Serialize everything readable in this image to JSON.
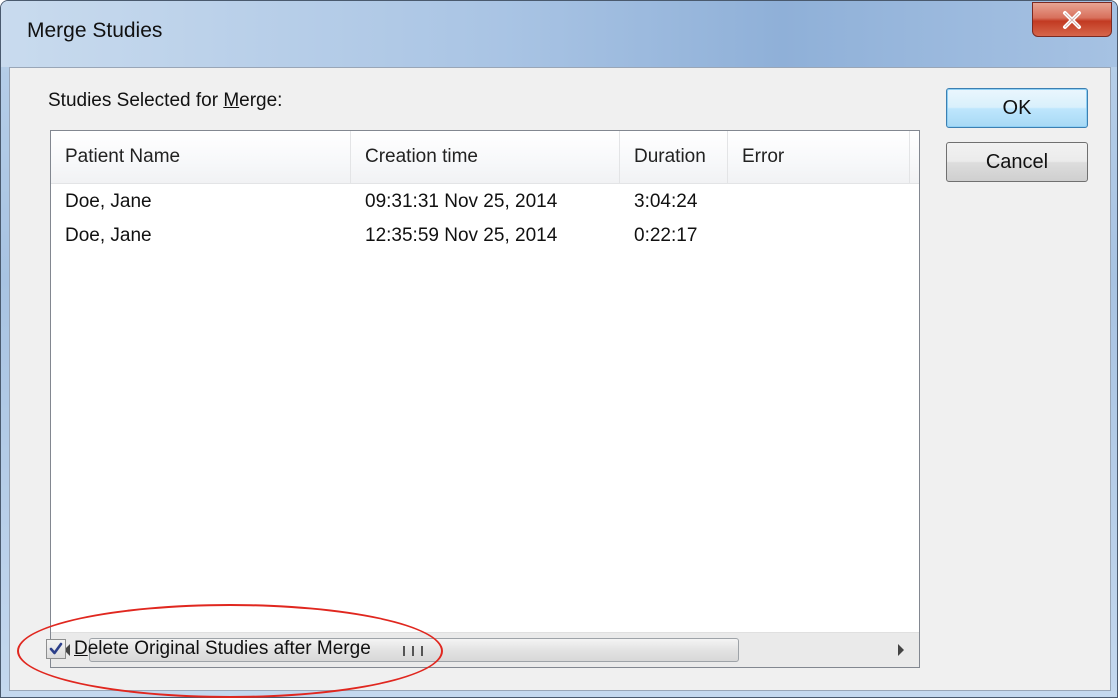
{
  "window": {
    "title": "Merge Studies",
    "close_symbol": "X"
  },
  "dialog": {
    "list_label_prefix": "Studies Selected for ",
    "list_label_accel": "M",
    "list_label_suffix": "erge:",
    "columns": [
      "Patient Name",
      "Creation time",
      "Duration",
      "Error"
    ],
    "rows": [
      {
        "patient": "Doe, Jane",
        "created": "09:31:31 Nov 25, 2014",
        "duration": "3:04:24",
        "error": ""
      },
      {
        "patient": "Doe, Jane",
        "created": "12:35:59 Nov 25, 2014",
        "duration": "0:22:17",
        "error": ""
      }
    ],
    "checkbox": {
      "accel": "D",
      "label_rest": "elete Original Studies after Merge",
      "checked": true
    }
  },
  "buttons": {
    "ok": "OK",
    "cancel": "Cancel"
  },
  "colors": {
    "annotation": "#e0271f",
    "close_button": "#c23a22",
    "default_button_border": "#3c7fb1"
  }
}
